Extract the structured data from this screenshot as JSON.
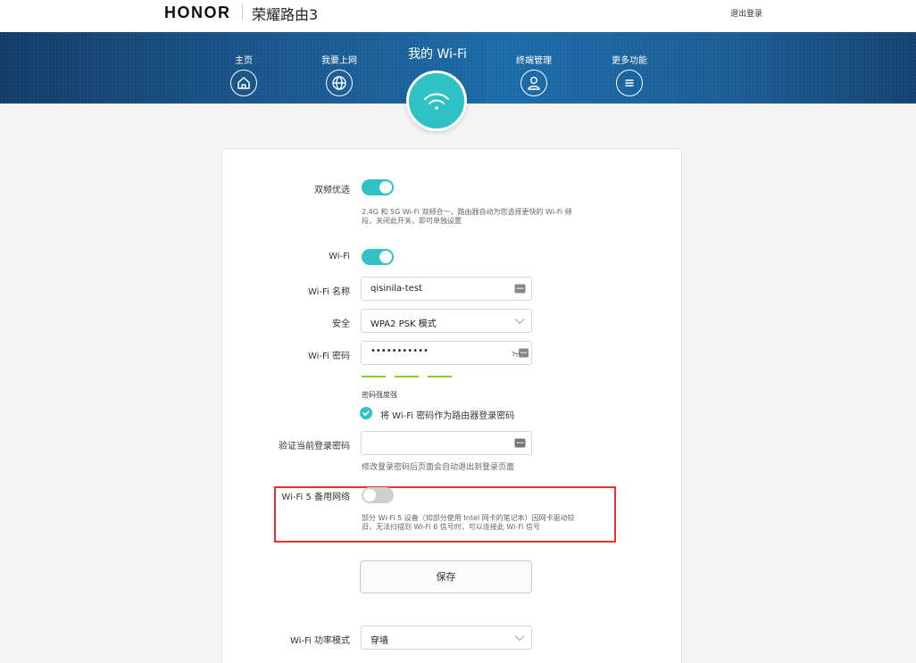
{
  "header": {
    "brand": "HONOR",
    "product": "荣耀路由3",
    "logout": "退出登录"
  },
  "nav": {
    "items": [
      {
        "label": "主页",
        "icon": "home-icon"
      },
      {
        "label": "我要上网",
        "icon": "globe-icon"
      },
      {
        "label": "终端管理",
        "icon": "user-icon"
      },
      {
        "label": "更多功能",
        "icon": "menu-icon"
      }
    ],
    "active": {
      "label": "我的 Wi-Fi",
      "icon": "wifi-icon"
    }
  },
  "form": {
    "dual_band": {
      "label": "双频优选",
      "enabled": true,
      "hint_line1": "2.4G 和 5G Wi-Fi 双频合一，路由器自动为您选择更快的 Wi-Fi 频",
      "hint_line2": "段，关闭此开关，即可单独设置"
    },
    "wifi": {
      "label": "Wi-Fi",
      "enabled": true
    },
    "wifi_name": {
      "label": "Wi-Fi 名称",
      "value": "qisinila-test"
    },
    "security": {
      "label": "安全",
      "value": "WPA2 PSK 模式"
    },
    "wifi_password": {
      "label": "Wi-Fi 密码",
      "value": "•••••••••••",
      "strength_label": "密码强度强"
    },
    "use_as_login": {
      "label": "将 Wi-Fi 密码作为路由器登录密码",
      "checked": true
    },
    "verify_login": {
      "label": "验证当前登录密码",
      "value": "",
      "hint": "修改登录密码后页面会自动退出到登录页面"
    },
    "wifi5_backup": {
      "label": "Wi-Fi 5 备用网络",
      "enabled": false,
      "hint_line1": "部分 Wi-Fi 5 设备（如部分使用 Intel 网卡的笔记本）因网卡驱动较",
      "hint_line2": "旧，无法扫描到 Wi-Fi 6 信号时，可以连接此 Wi-Fi 信号"
    },
    "save_label": "保存",
    "power_mode": {
      "label": "Wi-Fi 功率模式",
      "value": "穿墙"
    }
  },
  "colors": {
    "accent": "#2fc1c6",
    "highlight_box": "#e0322f",
    "strength_bar": "#7ed321"
  }
}
